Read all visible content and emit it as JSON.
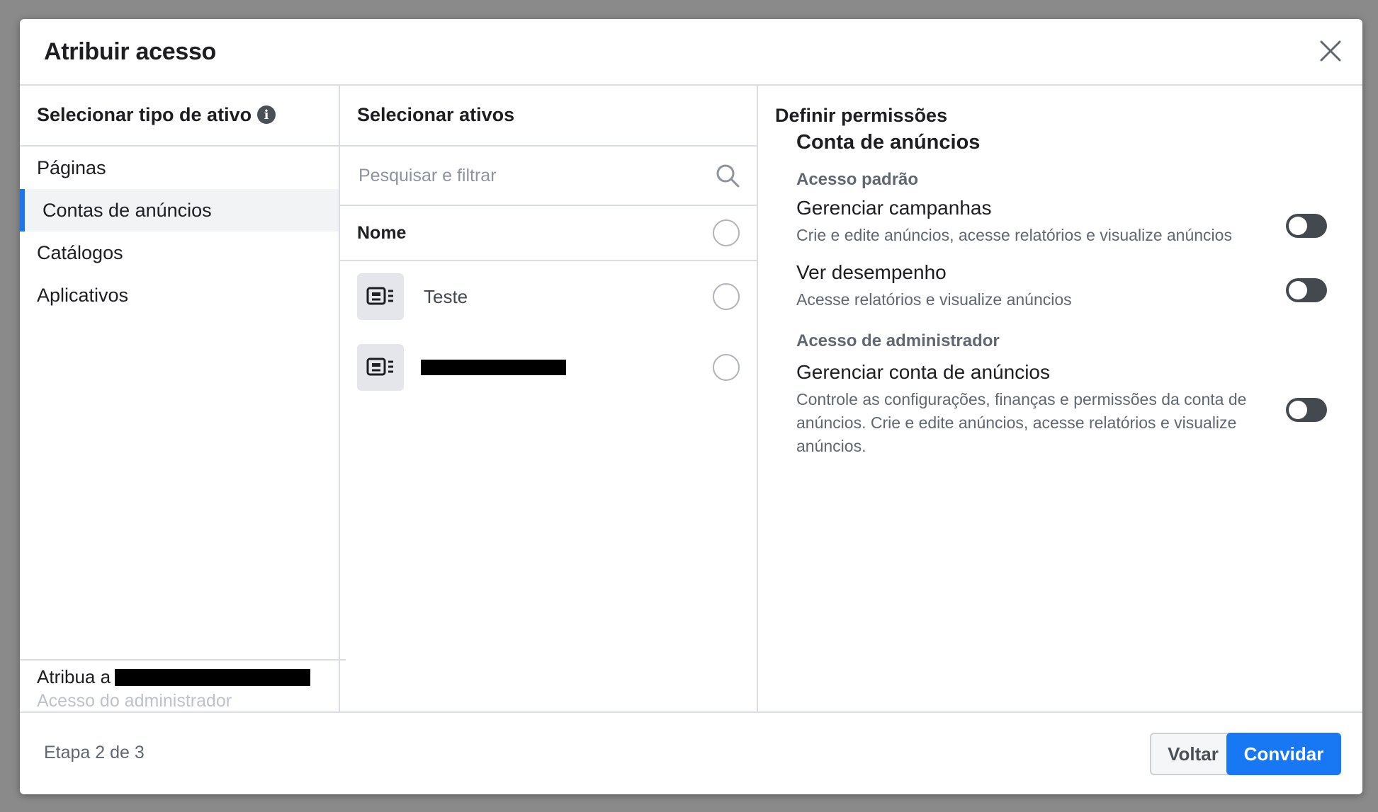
{
  "dialog": {
    "title": "Atribuir acesso"
  },
  "col1": {
    "header": "Selecionar tipo de ativo",
    "items": [
      {
        "label": "Páginas"
      },
      {
        "label": "Contas de anúncios",
        "selected": true
      },
      {
        "label": "Catálogos"
      },
      {
        "label": "Aplicativos"
      }
    ],
    "assign_prefix": "Atribua a",
    "assign_sub": "Acesso do administrador"
  },
  "col2": {
    "header": "Selecionar ativos",
    "search_placeholder": "Pesquisar e filtrar",
    "list_header": "Nome",
    "rows": [
      {
        "label": "Teste"
      },
      {
        "label": ""
      }
    ]
  },
  "col3": {
    "header": "Definir permissões",
    "asset_title": "Conta de anúncios",
    "standard_section": "Acesso padrão",
    "standard": [
      {
        "name": "Gerenciar campanhas",
        "desc": "Crie e edite anúncios, acesse relatórios e visualize anúncios",
        "enabled": false
      },
      {
        "name": "Ver desempenho",
        "desc": "Acesse relatórios e visualize anúncios",
        "enabled": false
      }
    ],
    "admin_section": "Acesso de administrador",
    "admin": [
      {
        "name": "Gerenciar conta de anúncios",
        "desc": "Controle as configurações, finanças e permissões da conta de anúncios. Crie e edite anúncios, acesse relatórios e visualize anúncios.",
        "enabled": false
      }
    ]
  },
  "footer": {
    "step": "Etapa 2 de 3",
    "back": "Voltar",
    "invite": "Convidar"
  },
  "colors": {
    "accent": "#1877f2",
    "toggle_off": "#444950"
  }
}
